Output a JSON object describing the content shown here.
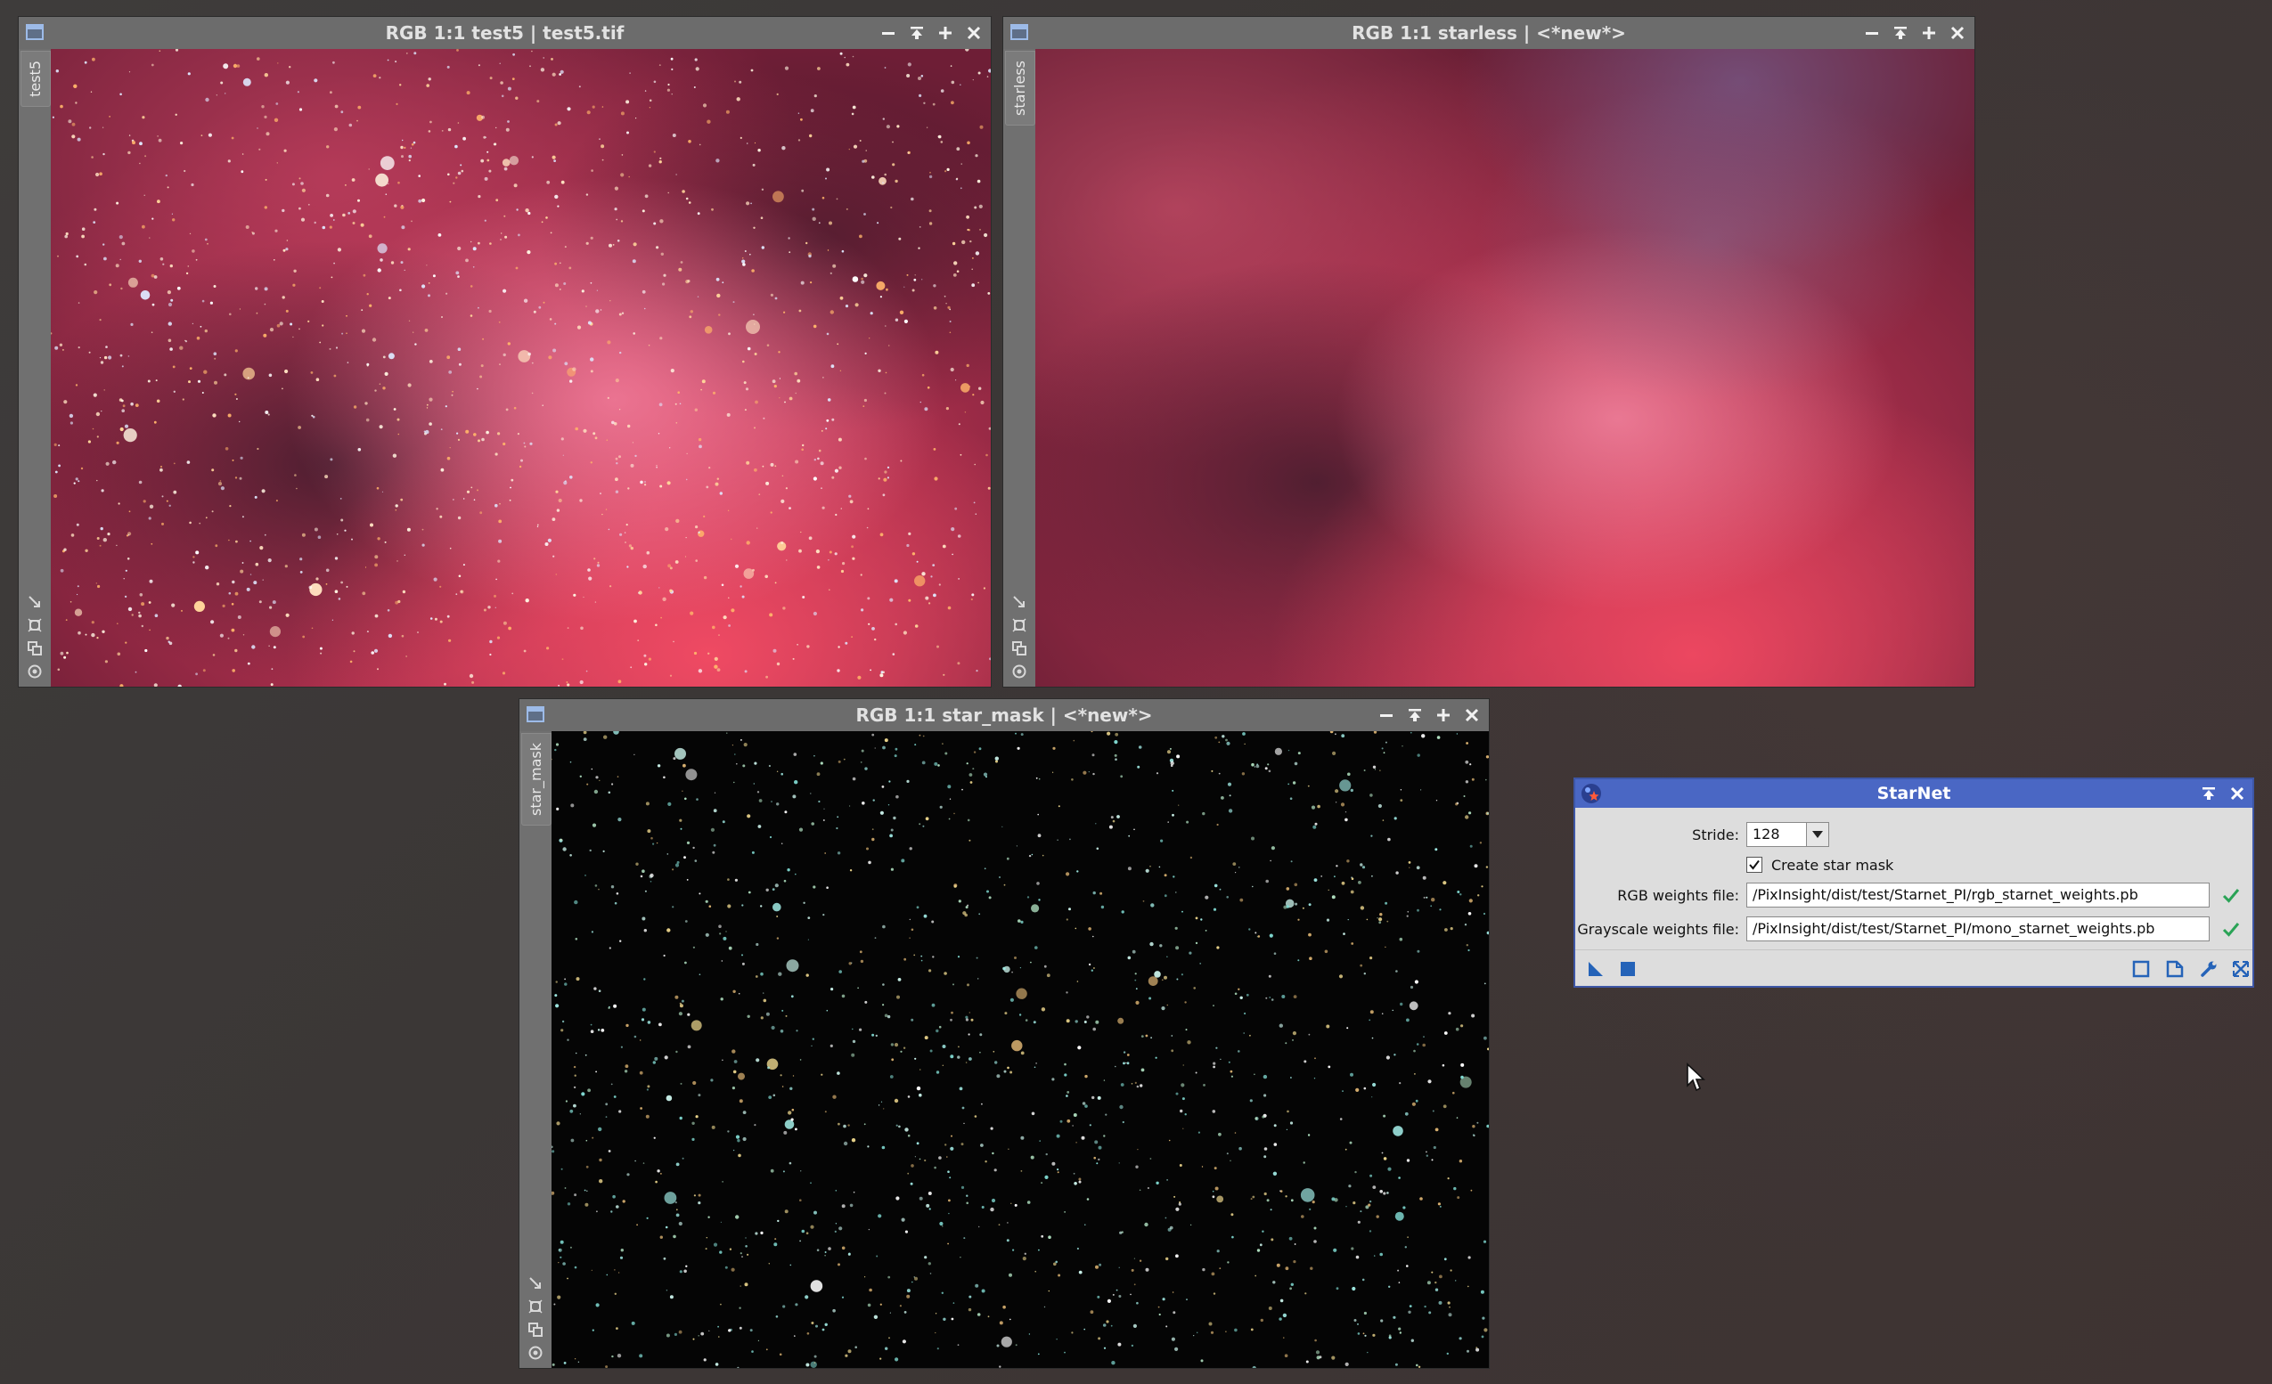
{
  "windows": [
    {
      "id": "test5",
      "title": "RGB 1:1 test5 | test5.tif",
      "tab": "test5"
    },
    {
      "id": "starless",
      "title": "RGB 1:1 starless | <*new*>",
      "tab": "starless"
    },
    {
      "id": "star_mask",
      "title": "RGB 1:1 star_mask | <*new*>",
      "tab": "star_mask"
    }
  ],
  "starnet": {
    "title": "StarNet",
    "stride_label": "Stride:",
    "stride_value": "128",
    "create_mask_label": "Create star mask",
    "create_mask_checked": true,
    "rgb_label": "RGB weights file:",
    "rgb_value": "/PixInsight/dist/test/Starnet_PI/rgb_starnet_weights.pb",
    "gray_label": "Grayscale weights file:",
    "gray_value": "/PixInsight/dist/test/Starnet_PI/mono_starnet_weights.pb"
  },
  "colors": {
    "dialog_title_bar": "#4a67c4",
    "valid_check": "#2aa356",
    "tool_icon": "#2563b8"
  },
  "icons": [
    "minimize-icon",
    "shade-icon",
    "maximize-icon",
    "close-icon",
    "apply-triangle-icon",
    "apply-global-icon",
    "preview-icon",
    "new-instance-icon",
    "wrench-icon",
    "reset-icon"
  ]
}
